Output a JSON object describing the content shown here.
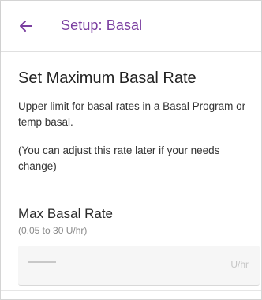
{
  "header": {
    "back_icon": "arrow-left-icon",
    "title": "Setup: Basal"
  },
  "main": {
    "title": "Set Maximum Basal Rate",
    "description": "Upper limit for basal rates in a Basal Program or temp basal.",
    "note": "(You can adjust this rate later if your needs change)",
    "field": {
      "label": "Max Basal Rate",
      "hint": "(0.05 to 30 U/hr)",
      "value_placeholder": "——",
      "unit": "U/hr"
    }
  },
  "colors": {
    "accent": "#7b3fa0",
    "text": "#222222",
    "muted": "#8a8a8a",
    "input_bg": "#f6f6f6"
  }
}
